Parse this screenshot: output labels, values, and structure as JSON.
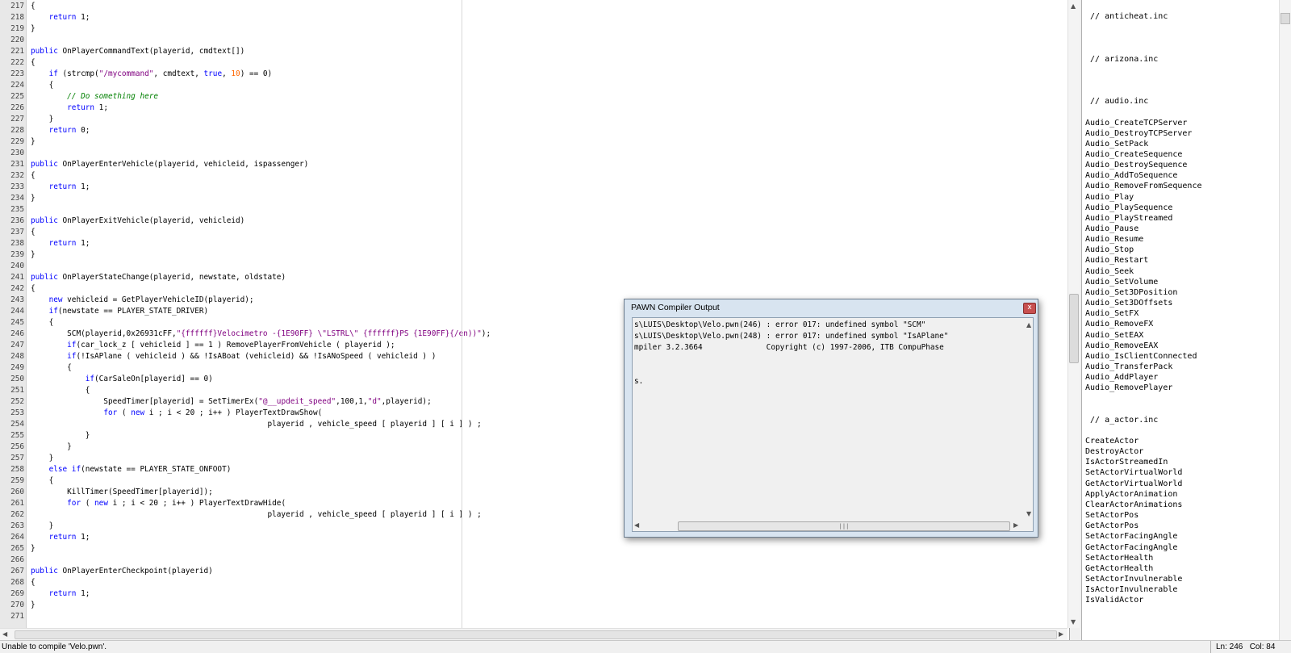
{
  "editor": {
    "lines": [
      {
        "n": "217",
        "code": [
          [
            "{",
            ""
          ]
        ]
      },
      {
        "n": "218",
        "code": [
          [
            "    ",
            ""
          ],
          [
            "return",
            "kw"
          ],
          [
            " 1;",
            ""
          ]
        ]
      },
      {
        "n": "219",
        "code": [
          [
            "}",
            ""
          ]
        ]
      },
      {
        "n": "220",
        "code": []
      },
      {
        "n": "221",
        "code": [
          [
            "public",
            "kw"
          ],
          [
            " OnPlayerCommandText(playerid, cmdtext[])",
            ""
          ]
        ]
      },
      {
        "n": "222",
        "code": [
          [
            "{",
            ""
          ]
        ]
      },
      {
        "n": "223",
        "code": [
          [
            "    ",
            ""
          ],
          [
            "if",
            "kw"
          ],
          [
            " (strcmp(",
            ""
          ],
          [
            "\"/mycommand\"",
            "str"
          ],
          [
            ", cmdtext, ",
            ""
          ],
          [
            "true",
            "kw"
          ],
          [
            ", ",
            ""
          ],
          [
            "10",
            "num"
          ],
          [
            ") == 0)",
            ""
          ]
        ]
      },
      {
        "n": "224",
        "code": [
          [
            "    {",
            ""
          ]
        ]
      },
      {
        "n": "225",
        "code": [
          [
            "        ",
            ""
          ],
          [
            "// Do something here",
            "cm"
          ]
        ]
      },
      {
        "n": "226",
        "code": [
          [
            "        ",
            ""
          ],
          [
            "return",
            "kw"
          ],
          [
            " 1;",
            ""
          ]
        ]
      },
      {
        "n": "227",
        "code": [
          [
            "    }",
            ""
          ]
        ]
      },
      {
        "n": "228",
        "code": [
          [
            "    ",
            ""
          ],
          [
            "return",
            "kw"
          ],
          [
            " 0;",
            ""
          ]
        ]
      },
      {
        "n": "229",
        "code": [
          [
            "}",
            ""
          ]
        ]
      },
      {
        "n": "230",
        "code": []
      },
      {
        "n": "231",
        "code": [
          [
            "public",
            "kw"
          ],
          [
            " OnPlayerEnterVehicle(playerid, vehicleid, ispassenger)",
            ""
          ]
        ]
      },
      {
        "n": "232",
        "code": [
          [
            "{",
            ""
          ]
        ]
      },
      {
        "n": "233",
        "code": [
          [
            "    ",
            ""
          ],
          [
            "return",
            "kw"
          ],
          [
            " 1;",
            ""
          ]
        ]
      },
      {
        "n": "234",
        "code": [
          [
            "}",
            ""
          ]
        ]
      },
      {
        "n": "235",
        "code": []
      },
      {
        "n": "236",
        "code": [
          [
            "public",
            "kw"
          ],
          [
            " OnPlayerExitVehicle(playerid, vehicleid)",
            ""
          ]
        ]
      },
      {
        "n": "237",
        "code": [
          [
            "{",
            ""
          ]
        ]
      },
      {
        "n": "238",
        "code": [
          [
            "    ",
            ""
          ],
          [
            "return",
            "kw"
          ],
          [
            " 1;",
            ""
          ]
        ]
      },
      {
        "n": "239",
        "code": [
          [
            "}",
            ""
          ]
        ]
      },
      {
        "n": "240",
        "code": []
      },
      {
        "n": "241",
        "code": [
          [
            "public",
            "kw"
          ],
          [
            " OnPlayerStateChange(playerid, newstate, oldstate)",
            ""
          ]
        ]
      },
      {
        "n": "242",
        "code": [
          [
            "{",
            ""
          ]
        ]
      },
      {
        "n": "243",
        "code": [
          [
            "    ",
            ""
          ],
          [
            "new",
            "kw"
          ],
          [
            " vehicleid = GetPlayerVehicleID(playerid);",
            ""
          ]
        ]
      },
      {
        "n": "244",
        "code": [
          [
            "    ",
            ""
          ],
          [
            "if",
            "kw"
          ],
          [
            "(newstate == PLAYER_STATE_DRIVER)",
            ""
          ]
        ]
      },
      {
        "n": "245",
        "code": [
          [
            "    {",
            ""
          ]
        ]
      },
      {
        "n": "246",
        "code": [
          [
            "        SCM(playerid,0x26931cFF,",
            ""
          ],
          [
            "\"{ffffff}Velocimetro -{1E90FF} \\\"LSTRL\\\" {ffffff}PS {1E90FF}{/en))\"",
            "str"
          ],
          [
            ");",
            ""
          ]
        ]
      },
      {
        "n": "247",
        "code": [
          [
            "        ",
            ""
          ],
          [
            "if",
            "kw"
          ],
          [
            "(car_lock_z [ vehicleid ] == 1 ) RemovePlayerFromVehicle ( playerid );",
            ""
          ]
        ]
      },
      {
        "n": "248",
        "code": [
          [
            "        ",
            ""
          ],
          [
            "if",
            "kw"
          ],
          [
            "(!IsAPlane ( vehicleid ) && !IsABoat (vehicleid) && !IsANoSpeed ( vehicleid ) )",
            ""
          ]
        ]
      },
      {
        "n": "249",
        "code": [
          [
            "        {",
            ""
          ]
        ]
      },
      {
        "n": "250",
        "code": [
          [
            "            ",
            ""
          ],
          [
            "if",
            "kw"
          ],
          [
            "(CarSaleOn[playerid] == 0)",
            ""
          ]
        ]
      },
      {
        "n": "251",
        "code": [
          [
            "            {",
            ""
          ]
        ]
      },
      {
        "n": "252",
        "code": [
          [
            "                SpeedTimer[playerid] = SetTimerEx(",
            ""
          ],
          [
            "\"@__updeit_speed\"",
            "str"
          ],
          [
            ",100,1,",
            ""
          ],
          [
            "\"d\"",
            "str"
          ],
          [
            ",playerid);",
            ""
          ]
        ]
      },
      {
        "n": "253",
        "code": [
          [
            "                ",
            ""
          ],
          [
            "for",
            "kw"
          ],
          [
            " ( ",
            ""
          ],
          [
            "new",
            "kw"
          ],
          [
            " i ; i < 20 ; i++ ) PlayerTextDrawShow(",
            ""
          ]
        ]
      },
      {
        "n": "254",
        "code": [
          [
            "                                                    playerid , vehicle_speed [ playerid ] [ i ] ) ;",
            ""
          ]
        ]
      },
      {
        "n": "255",
        "code": [
          [
            "            }",
            ""
          ]
        ]
      },
      {
        "n": "256",
        "code": [
          [
            "        }",
            ""
          ]
        ]
      },
      {
        "n": "257",
        "code": [
          [
            "    }",
            ""
          ]
        ]
      },
      {
        "n": "258",
        "code": [
          [
            "    ",
            ""
          ],
          [
            "else if",
            "kw"
          ],
          [
            "(newstate == PLAYER_STATE_ONFOOT)",
            ""
          ]
        ]
      },
      {
        "n": "259",
        "code": [
          [
            "    {",
            ""
          ]
        ]
      },
      {
        "n": "260",
        "code": [
          [
            "        KillTimer(SpeedTimer[playerid]);",
            ""
          ]
        ]
      },
      {
        "n": "261",
        "code": [
          [
            "        ",
            ""
          ],
          [
            "for",
            "kw"
          ],
          [
            " ( ",
            ""
          ],
          [
            "new",
            "kw"
          ],
          [
            " i ; i < 20 ; i++ ) PlayerTextDrawHide(",
            ""
          ]
        ]
      },
      {
        "n": "262",
        "code": [
          [
            "                                                    playerid , vehicle_speed [ playerid ] [ i ] ) ;",
            ""
          ]
        ]
      },
      {
        "n": "263",
        "code": [
          [
            "    }",
            ""
          ]
        ]
      },
      {
        "n": "264",
        "code": [
          [
            "    ",
            ""
          ],
          [
            "return",
            "kw"
          ],
          [
            " 1;",
            ""
          ]
        ]
      },
      {
        "n": "265",
        "code": [
          [
            "}",
            ""
          ]
        ]
      },
      {
        "n": "266",
        "code": []
      },
      {
        "n": "267",
        "code": [
          [
            "public",
            "kw"
          ],
          [
            " OnPlayerEnterCheckpoint(playerid)",
            ""
          ]
        ]
      },
      {
        "n": "268",
        "code": [
          [
            "{",
            ""
          ]
        ]
      },
      {
        "n": "269",
        "code": [
          [
            "    ",
            ""
          ],
          [
            "return",
            "kw"
          ],
          [
            " 1;",
            ""
          ]
        ]
      },
      {
        "n": "270",
        "code": [
          [
            "}",
            ""
          ]
        ]
      },
      {
        "n": "271",
        "code": []
      }
    ]
  },
  "sidebar": {
    "items": [
      {
        "text": " // anticheat.inc",
        "line": 1
      },
      {
        "text": " // arizona.inc",
        "line": 5
      },
      {
        "text": " // audio.inc",
        "line": 9
      },
      {
        "text": "Audio_CreateTCPServer",
        "line": 11
      },
      {
        "text": "Audio_DestroyTCPServer",
        "line": 12
      },
      {
        "text": "Audio_SetPack",
        "line": 13
      },
      {
        "text": "Audio_CreateSequence",
        "line": 14
      },
      {
        "text": "Audio_DestroySequence",
        "line": 15
      },
      {
        "text": "Audio_AddToSequence",
        "line": 16
      },
      {
        "text": "Audio_RemoveFromSequence",
        "line": 17
      },
      {
        "text": "Audio_Play",
        "line": 18
      },
      {
        "text": "Audio_PlaySequence",
        "line": 19
      },
      {
        "text": "Audio_PlayStreamed",
        "line": 20
      },
      {
        "text": "Audio_Pause",
        "line": 21
      },
      {
        "text": "Audio_Resume",
        "line": 22
      },
      {
        "text": "Audio_Stop",
        "line": 23
      },
      {
        "text": "Audio_Restart",
        "line": 24
      },
      {
        "text": "Audio_Seek",
        "line": 25
      },
      {
        "text": "Audio_SetVolume",
        "line": 26
      },
      {
        "text": "Audio_Set3DPosition",
        "line": 27
      },
      {
        "text": "Audio_Set3DOffsets",
        "line": 28
      },
      {
        "text": "Audio_SetFX",
        "line": 29
      },
      {
        "text": "Audio_RemoveFX",
        "line": 30
      },
      {
        "text": "Audio_SetEAX",
        "line": 31
      },
      {
        "text": "Audio_RemoveEAX",
        "line": 32
      },
      {
        "text": "Audio_IsClientConnected",
        "line": 33
      },
      {
        "text": "Audio_TransferPack",
        "line": 34
      },
      {
        "text": "Audio_AddPlayer",
        "line": 35
      },
      {
        "text": "Audio_RemovePlayer",
        "line": 36
      },
      {
        "text": " // a_actor.inc",
        "line": 39
      },
      {
        "text": "CreateActor",
        "line": 41
      },
      {
        "text": "DestroyActor",
        "line": 42
      },
      {
        "text": "IsActorStreamedIn",
        "line": 43
      },
      {
        "text": "SetActorVirtualWorld",
        "line": 44
      },
      {
        "text": "GetActorVirtualWorld",
        "line": 45
      },
      {
        "text": "ApplyActorAnimation",
        "line": 46
      },
      {
        "text": "ClearActorAnimations",
        "line": 47
      },
      {
        "text": "SetActorPos",
        "line": 48
      },
      {
        "text": "GetActorPos",
        "line": 49
      },
      {
        "text": "SetActorFacingAngle",
        "line": 50
      },
      {
        "text": "GetActorFacingAngle",
        "line": 51
      },
      {
        "text": "SetActorHealth",
        "line": 52
      },
      {
        "text": "GetActorHealth",
        "line": 53
      },
      {
        "text": "SetActorInvulnerable",
        "line": 54
      },
      {
        "text": "IsActorInvulnerable",
        "line": 55
      },
      {
        "text": "IsValidActor",
        "line": 56
      }
    ]
  },
  "compiler_dialog": {
    "title": "PAWN Compiler Output",
    "close_label": "x",
    "output_lines": [
      {
        "text": "s\\LUIS\\Desktop\\Velo.pwn(246) : error 017: undefined symbol \"SCM\"",
        "line": 0
      },
      {
        "text": "s\\LUIS\\Desktop\\Velo.pwn(248) : error 017: undefined symbol \"IsAPlane\"",
        "line": 1
      },
      {
        "text": "mpiler 3.2.3664              Copyright (c) 1997-2006, ITB CompuPhase",
        "line": 2
      },
      {
        "text": "s.",
        "line": 5
      }
    ]
  },
  "status_bar": {
    "message": "Unable to compile 'Velo.pwn'.",
    "position": "Ln: 246   Col: 84"
  }
}
